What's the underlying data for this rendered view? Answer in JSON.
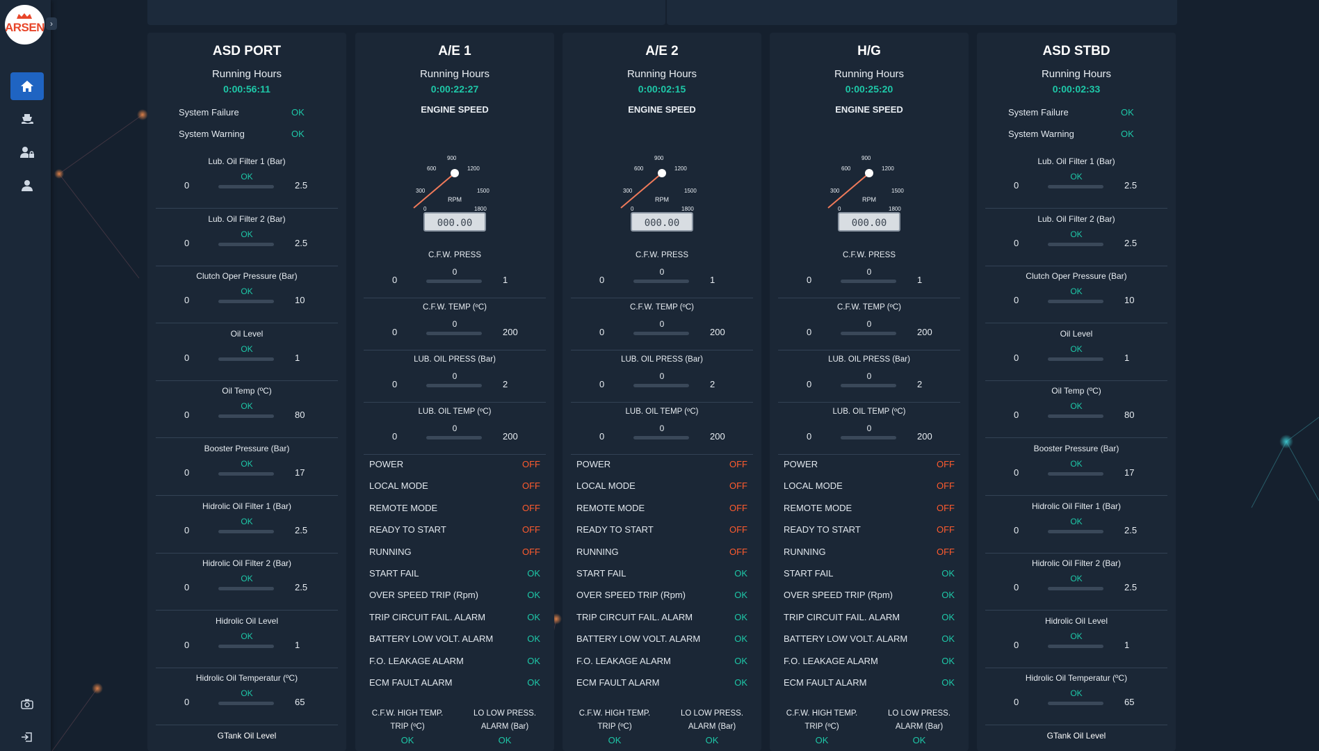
{
  "app": {
    "logo_text": "ARSEN"
  },
  "sidebar": {
    "items": [
      {
        "name": "home",
        "icon": "home-icon",
        "active": true
      },
      {
        "name": "ship",
        "icon": "ship-icon",
        "active": false
      },
      {
        "name": "user-lock",
        "icon": "user-lock-icon",
        "active": false
      },
      {
        "name": "user",
        "icon": "user-icon",
        "active": false
      }
    ],
    "bottom": [
      {
        "name": "camera",
        "icon": "camera-icon"
      },
      {
        "name": "logout",
        "icon": "logout-icon"
      }
    ]
  },
  "colors": {
    "ok": "#1ec8a8",
    "off": "#ff5b2e",
    "accent": "#1f64c2"
  },
  "asd_port": {
    "title": "ASD PORT",
    "running_label": "Running Hours",
    "running_value": "0:00:56:11",
    "system": [
      {
        "label": "System Failure",
        "value": "OK"
      },
      {
        "label": "System Warning",
        "value": "OK"
      }
    ],
    "gauges": [
      {
        "label": "Lub. Oil Filter 1 (Bar)",
        "status": "OK",
        "min": "0",
        "max": "2.5"
      },
      {
        "label": "Lub. Oil Filter 2 (Bar)",
        "status": "OK",
        "min": "0",
        "max": "2.5"
      },
      {
        "label": "Clutch Oper Pressure (Bar)",
        "status": "OK",
        "min": "0",
        "max": "10"
      },
      {
        "label": "Oil Level",
        "status": "OK",
        "min": "0",
        "max": "1"
      },
      {
        "label": "Oil Temp (ºC)",
        "status": "OK",
        "min": "0",
        "max": "80"
      },
      {
        "label": "Booster Pressure (Bar)",
        "status": "OK",
        "min": "0",
        "max": "17"
      },
      {
        "label": "Hidrolic Oil Filter 1 (Bar)",
        "status": "OK",
        "min": "0",
        "max": "2.5"
      },
      {
        "label": "Hidrolic Oil Filter 2 (Bar)",
        "status": "OK",
        "min": "0",
        "max": "2.5"
      },
      {
        "label": "Hidrolic Oil Level",
        "status": "OK",
        "min": "0",
        "max": "1"
      },
      {
        "label": "Hidrolic Oil Temperatur (ºC)",
        "status": "OK",
        "min": "0",
        "max": "65"
      }
    ],
    "last_label": "GTank Oil Level"
  },
  "asd_stbd": {
    "title": "ASD STBD",
    "running_label": "Running Hours",
    "running_value": "0:00:02:33",
    "system": [
      {
        "label": "System Failure",
        "value": "OK"
      },
      {
        "label": "System Warning",
        "value": "OK"
      }
    ],
    "gauges": [
      {
        "label": "Lub. Oil Filter 1 (Bar)",
        "status": "OK",
        "min": "0",
        "max": "2.5"
      },
      {
        "label": "Lub. Oil Filter 2 (Bar)",
        "status": "OK",
        "min": "0",
        "max": "2.5"
      },
      {
        "label": "Clutch Oper Pressure (Bar)",
        "status": "OK",
        "min": "0",
        "max": "10"
      },
      {
        "label": "Oil Level",
        "status": "OK",
        "min": "0",
        "max": "1"
      },
      {
        "label": "Oil Temp (ºC)",
        "status": "OK",
        "min": "0",
        "max": "80"
      },
      {
        "label": "Booster Pressure (Bar)",
        "status": "OK",
        "min": "0",
        "max": "17"
      },
      {
        "label": "Hidrolic Oil Filter 1 (Bar)",
        "status": "OK",
        "min": "0",
        "max": "2.5"
      },
      {
        "label": "Hidrolic Oil Filter 2 (Bar)",
        "status": "OK",
        "min": "0",
        "max": "2.5"
      },
      {
        "label": "Hidrolic Oil Level",
        "status": "OK",
        "min": "0",
        "max": "1"
      },
      {
        "label": "Hidrolic Oil Temperatur (ºC)",
        "status": "OK",
        "min": "0",
        "max": "65"
      }
    ],
    "last_label": "GTank Oil Level"
  },
  "engine_common": {
    "running_label": "Running Hours",
    "speed_label": "ENGINE SPEED",
    "rpm_label": "RPM",
    "rpm_display": "000.00",
    "rpm_ticks": [
      "0",
      "300",
      "600",
      "900",
      "1200",
      "1500",
      "1800"
    ],
    "gauges": [
      {
        "label": "C.F.W. PRESS",
        "value": "0",
        "min": "0",
        "max": "1"
      },
      {
        "label": "C.F.W. TEMP (ºC)",
        "value": "0",
        "min": "0",
        "max": "200"
      },
      {
        "label": "LUB. OIL PRESS (Bar)",
        "value": "0",
        "min": "0",
        "max": "2"
      },
      {
        "label": "LUB. OIL TEMP (ºC)",
        "value": "0",
        "min": "0",
        "max": "200"
      }
    ],
    "statuses": [
      {
        "label": "POWER",
        "value": "OFF"
      },
      {
        "label": "LOCAL MODE",
        "value": "OFF"
      },
      {
        "label": "REMOTE MODE",
        "value": "OFF"
      },
      {
        "label": "READY TO START",
        "value": "OFF"
      },
      {
        "label": "RUNNING",
        "value": "OFF"
      },
      {
        "label": "START FAIL",
        "value": "OK"
      },
      {
        "label": "OVER SPEED TRIP (Rpm)",
        "value": "OK"
      },
      {
        "label": "TRIP CIRCUIT FAIL. ALARM",
        "value": "OK"
      },
      {
        "label": "BATTERY LOW VOLT. ALARM",
        "value": "OK"
      },
      {
        "label": "F.O. LEAKAGE ALARM",
        "value": "OK"
      },
      {
        "label": "ECM FAULT ALARM",
        "value": "OK"
      }
    ],
    "footer": [
      {
        "label_1": "C.F.W. HIGH TEMP.",
        "label_2": "TRIP (ºC)",
        "value": "OK"
      },
      {
        "label_1": "LO LOW PRESS.",
        "label_2": "ALARM (Bar)",
        "value": "OK"
      }
    ]
  },
  "engines": [
    {
      "title": "A/E 1",
      "running_value": "0:00:22:27",
      "rpm": 0
    },
    {
      "title": "A/E 2",
      "running_value": "0:00:02:15",
      "rpm": 0
    },
    {
      "title": "H/G",
      "running_value": "0:00:25:20",
      "rpm": 0
    }
  ]
}
